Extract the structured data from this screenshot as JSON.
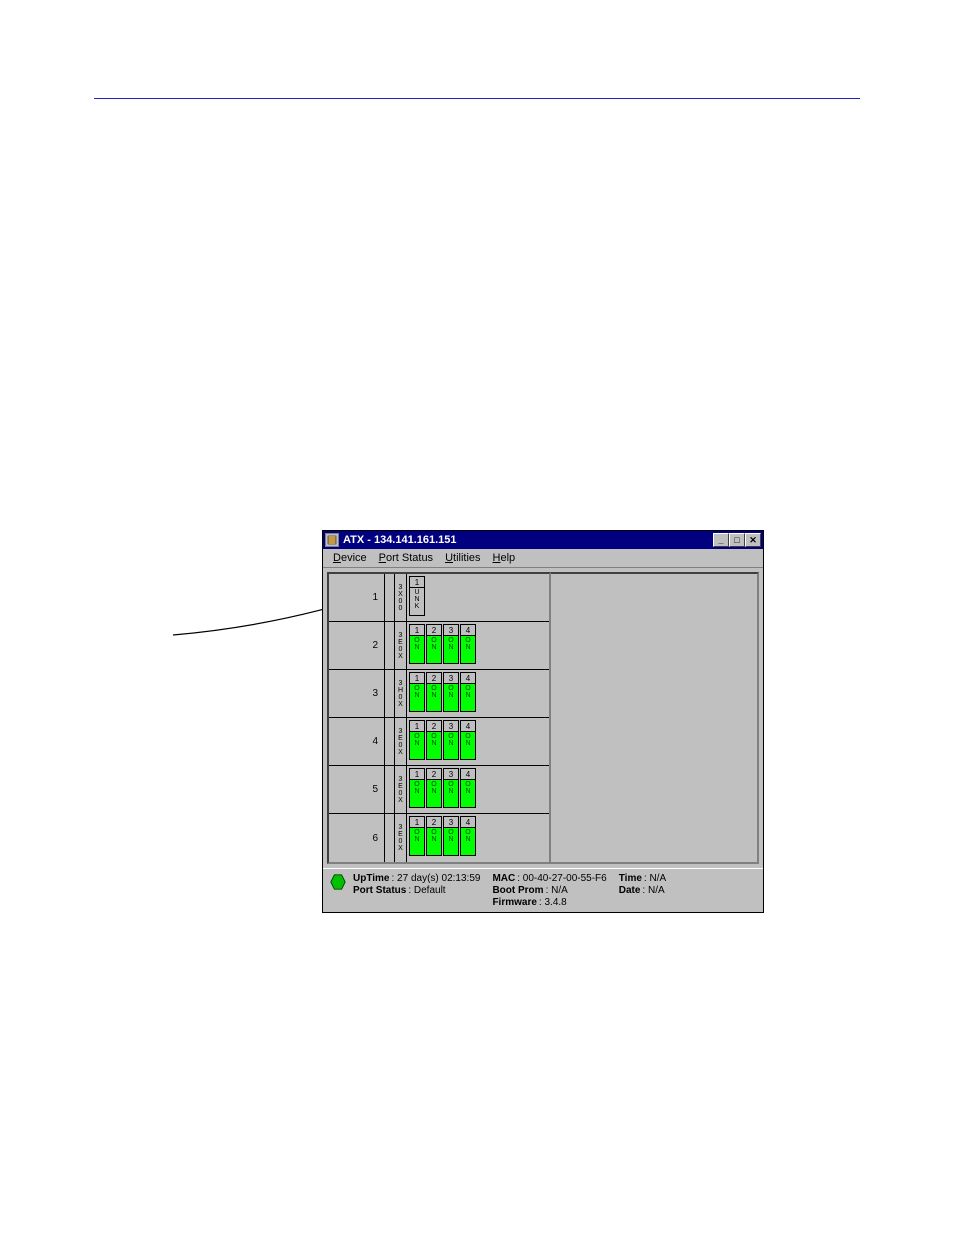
{
  "window": {
    "title": "ATX - 134.141.161.151"
  },
  "menu": {
    "device": "Device",
    "port_status": "Port Status",
    "utilities": "Utilities",
    "help": "Help"
  },
  "slots": [
    {
      "num": "1",
      "module": "3X00",
      "ports": [
        {
          "num": "1",
          "status": "UNK",
          "class": "unk"
        }
      ]
    },
    {
      "num": "2",
      "module": "3E0X",
      "ports": [
        {
          "num": "1",
          "status": "ON",
          "class": "on"
        },
        {
          "num": "2",
          "status": "ON",
          "class": "on"
        },
        {
          "num": "3",
          "status": "ON",
          "class": "on"
        },
        {
          "num": "4",
          "status": "ON",
          "class": "on"
        }
      ]
    },
    {
      "num": "3",
      "module": "3H0X",
      "ports": [
        {
          "num": "1",
          "status": "ON",
          "class": "on"
        },
        {
          "num": "2",
          "status": "ON",
          "class": "on"
        },
        {
          "num": "3",
          "status": "ON",
          "class": "on"
        },
        {
          "num": "4",
          "status": "ON",
          "class": "on"
        }
      ]
    },
    {
      "num": "4",
      "module": "3E0X",
      "ports": [
        {
          "num": "1",
          "status": "ON",
          "class": "on"
        },
        {
          "num": "2",
          "status": "ON",
          "class": "on"
        },
        {
          "num": "3",
          "status": "ON",
          "class": "on"
        },
        {
          "num": "4",
          "status": "ON",
          "class": "on"
        }
      ]
    },
    {
      "num": "5",
      "module": "3E0X",
      "ports": [
        {
          "num": "1",
          "status": "ON",
          "class": "on"
        },
        {
          "num": "2",
          "status": "ON",
          "class": "on"
        },
        {
          "num": "3",
          "status": "ON",
          "class": "on"
        },
        {
          "num": "4",
          "status": "ON",
          "class": "on"
        }
      ]
    },
    {
      "num": "6",
      "module": "3E0X",
      "ports": [
        {
          "num": "1",
          "status": "ON",
          "class": "on"
        },
        {
          "num": "2",
          "status": "ON",
          "class": "on"
        },
        {
          "num": "3",
          "status": "ON",
          "class": "on"
        },
        {
          "num": "4",
          "status": "ON",
          "class": "on"
        }
      ]
    }
  ],
  "status": {
    "uptime_label": "UpTime",
    "uptime_value": ": 27 day(s) 02:13:59",
    "portstatus_label": "Port Status",
    "portstatus_value": ": Default",
    "mac_label": "MAC",
    "mac_value": ": 00-40-27-00-55-F6",
    "bootprom_label": "Boot Prom",
    "bootprom_value": ": N/A",
    "firmware_label": "Firmware",
    "firmware_value": ": 3.4.8",
    "time_label": "Time",
    "time_value": ": N/A",
    "date_label": "Date",
    "date_value": ": N/A"
  }
}
